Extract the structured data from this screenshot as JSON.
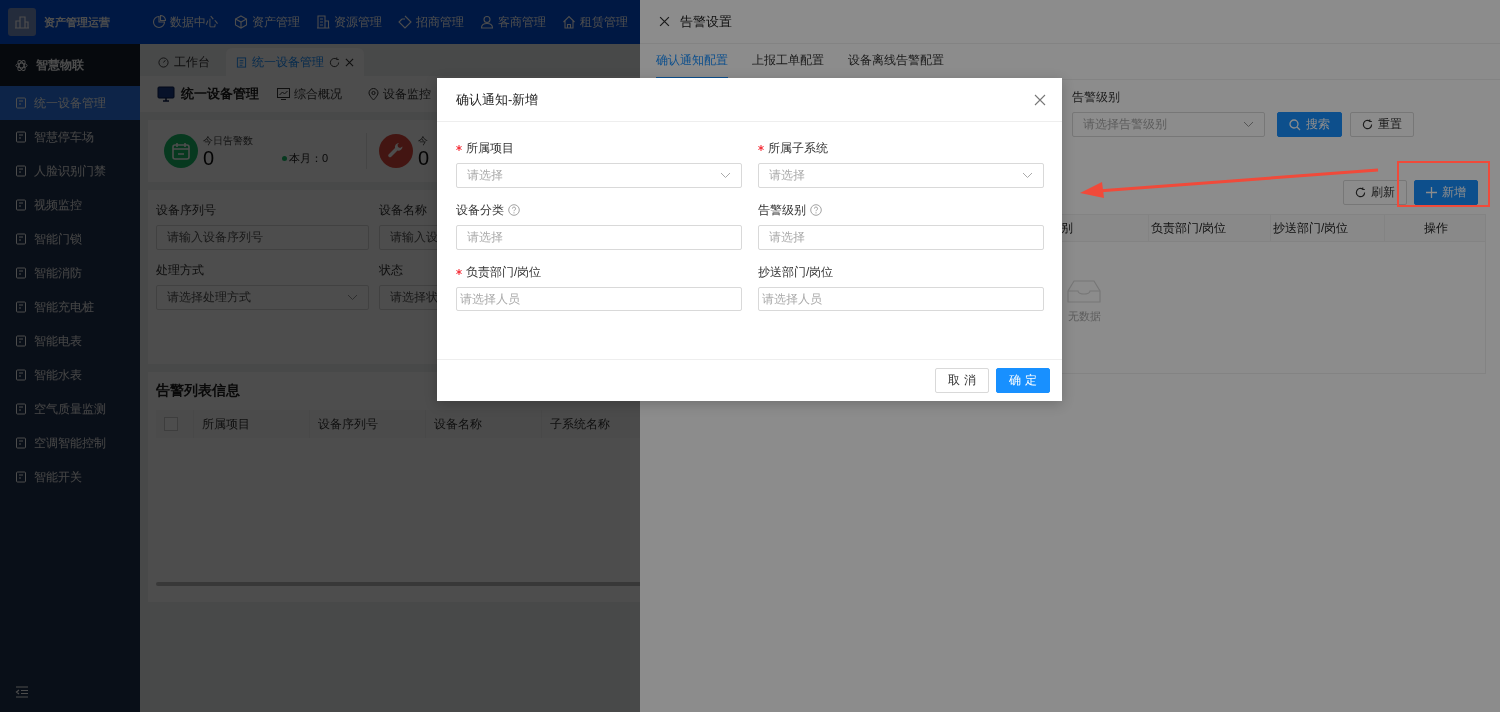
{
  "top_bar": {
    "app_name": "资产管理运营",
    "nav": [
      {
        "label": "数据中心"
      },
      {
        "label": "资产管理"
      },
      {
        "label": "资源管理"
      },
      {
        "label": "招商管理"
      },
      {
        "label": "客商管理"
      },
      {
        "label": "租赁管理"
      }
    ]
  },
  "sidebar": {
    "section": "智慧物联",
    "items": [
      {
        "label": "统一设备管理",
        "selected": true
      },
      {
        "label": "智慧停车场",
        "selected": false
      },
      {
        "label": "人脸识别门禁",
        "selected": false
      },
      {
        "label": "视频监控",
        "selected": false
      },
      {
        "label": "智能门锁",
        "selected": false
      },
      {
        "label": "智能消防",
        "selected": false
      },
      {
        "label": "智能充电桩",
        "selected": false
      },
      {
        "label": "智能电表",
        "selected": false
      },
      {
        "label": "智能水表",
        "selected": false
      },
      {
        "label": "空气质量监测",
        "selected": false
      },
      {
        "label": "空调智能控制",
        "selected": false
      },
      {
        "label": "智能开关",
        "selected": false
      }
    ]
  },
  "tabs": [
    {
      "label": "工作台",
      "selected": false
    },
    {
      "label": "统一设备管理",
      "selected": true
    }
  ],
  "page": {
    "title": "统一设备管理",
    "subtabs": [
      "综合概况",
      "设备监控"
    ]
  },
  "stats": [
    {
      "label": "今日告警数",
      "value": "0",
      "month": "本月：0"
    },
    {
      "label": "今",
      "value": "0"
    }
  ],
  "filters": [
    {
      "label": "设备序列号",
      "placeholder": "请输入设备序列号",
      "kind": "input"
    },
    {
      "label": "设备名称",
      "placeholder": "请输入设",
      "kind": "input"
    },
    {
      "label": "处理方式",
      "placeholder": "请选择处理方式",
      "kind": "select"
    },
    {
      "label": "状态",
      "placeholder": "请选择状",
      "kind": "input"
    }
  ],
  "alarm_list": {
    "title": "告警列表信息",
    "select_all": {
      "checked": false
    },
    "columns": [
      "所属项目",
      "设备序列号",
      "设备名称",
      "子系统名称"
    ]
  },
  "drawer": {
    "title": "告警设置",
    "tabs": [
      {
        "label": "确认通知配置",
        "selected": true
      },
      {
        "label": "上报工单配置",
        "selected": false
      },
      {
        "label": "设备离线告警配置",
        "selected": false
      }
    ],
    "filter": {
      "label": "告警级别",
      "placeholder": "请选择告警级别"
    },
    "search_button": "搜索",
    "reset_button": "重置",
    "refresh_button": "刷新",
    "add_button": "新增",
    "columns": [
      "别",
      "负责部门/岗位",
      "抄送部门/岗位",
      "操作"
    ],
    "empty_text": "无数据"
  },
  "modal": {
    "title": "确认通知-新增",
    "fields": [
      {
        "label": "所属项目",
        "required": true,
        "help": false,
        "placeholder": "请选择",
        "kind": "select"
      },
      {
        "label": "所属子系统",
        "required": true,
        "help": false,
        "placeholder": "请选择",
        "kind": "select"
      },
      {
        "label": "设备分类",
        "required": false,
        "help": true,
        "placeholder": "请选择",
        "kind": "input"
      },
      {
        "label": "告警级别",
        "required": false,
        "help": true,
        "placeholder": "请选择",
        "kind": "input"
      },
      {
        "label": "负责部门/岗位",
        "required": true,
        "help": false,
        "placeholder": "请选择人员",
        "kind": "people"
      },
      {
        "label": "抄送部门/岗位",
        "required": false,
        "help": false,
        "placeholder": "请选择人员",
        "kind": "people"
      }
    ],
    "cancel_button": "取消",
    "ok_button": "确定"
  }
}
